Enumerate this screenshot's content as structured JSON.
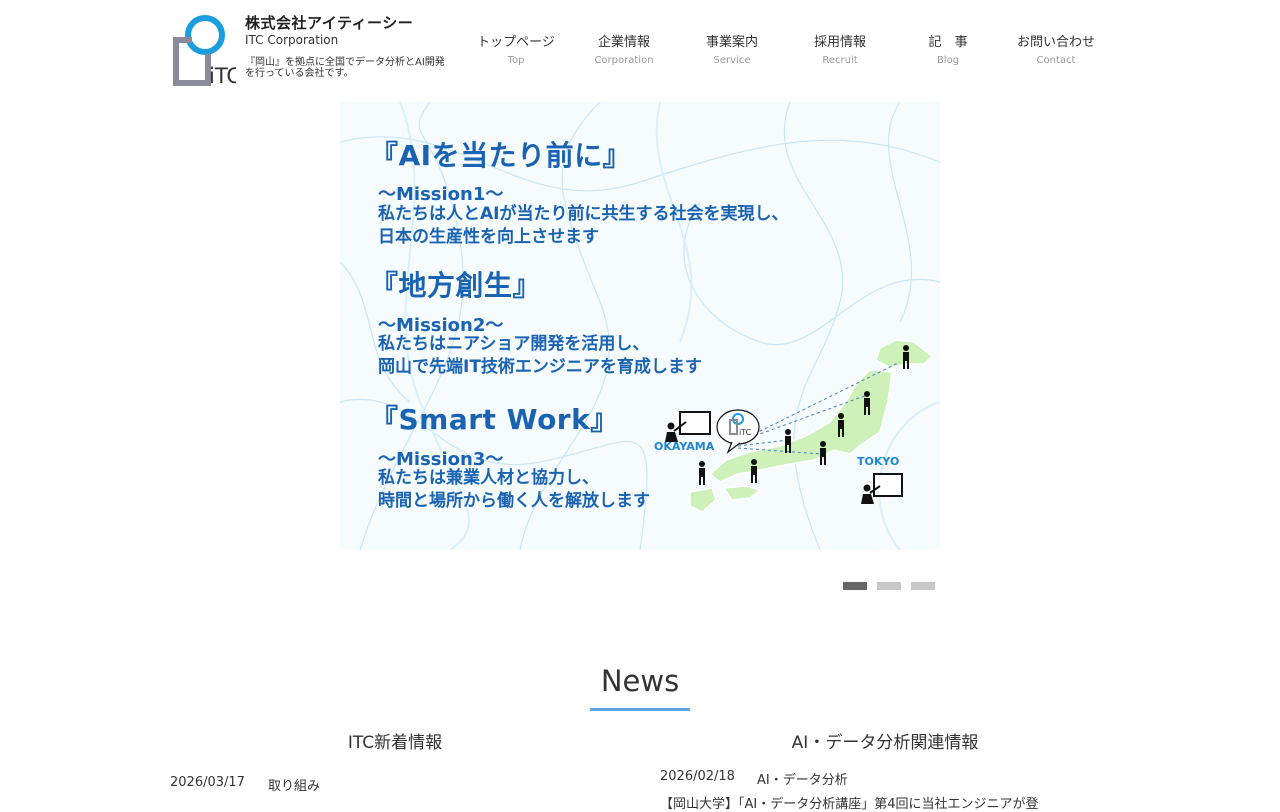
{
  "header": {
    "company_name": "株式会社アイティーシー",
    "company_en": "ITC Corporation",
    "tagline": "『岡山』を拠点に全国でデータ分析とAI開発を行っている会社です。",
    "logo_text": "iTC"
  },
  "nav": [
    {
      "jp": "トップページ",
      "en": "Top"
    },
    {
      "jp": "企業情報",
      "en": "Corporation"
    },
    {
      "jp": "事業案内",
      "en": "Service"
    },
    {
      "jp": "採用情報",
      "en": "Recruit"
    },
    {
      "jp": "記　事",
      "en": "Blog"
    },
    {
      "jp": "お問い合わせ",
      "en": "Contact"
    }
  ],
  "slide": {
    "heading1": "『AIを当たり前に』",
    "mission1": "～Mission1～",
    "mission1_line1": "私たちは人とAIが当たり前に共生する社会を実現し、",
    "mission1_line2": "日本の生産性を向上させます",
    "heading2": "『地方創生』",
    "mission2": "～Mission2～",
    "mission2_line1": "私たちはニアショア開発を活用し、",
    "mission2_line2": "岡山で先端IT技術エンジニアを育成します",
    "heading3": "『Smart Work』",
    "mission3": "～Mission3～",
    "mission3_line1": "私たちは兼業人材と協力し、",
    "mission3_line2": "時間と場所から働く人を解放します",
    "label_okayama": "OKAYAMA",
    "label_tokyo": "TOKYO",
    "badge_text": "iTC"
  },
  "slider_dots": {
    "count": 3,
    "active_index": 0
  },
  "news": {
    "title": "News",
    "left": {
      "title": "ITC新着情報",
      "items": [
        {
          "date": "2026/03/17",
          "category": "取り組み"
        }
      ]
    },
    "right": {
      "title": "AI・データ分析関連情報",
      "items": [
        {
          "date": "2026/02/18",
          "category": "AI・データ分析",
          "title": "【岡山大学】「AI・データ分析講座」第4回に当社エンジニアが登"
        }
      ]
    }
  },
  "colors": {
    "accent": "#1a63b2",
    "logo_blue": "#1a9ee0",
    "logo_gray": "#8a8a9a",
    "underline": "#5aa7e4",
    "map_green": "#cdf1b8"
  }
}
